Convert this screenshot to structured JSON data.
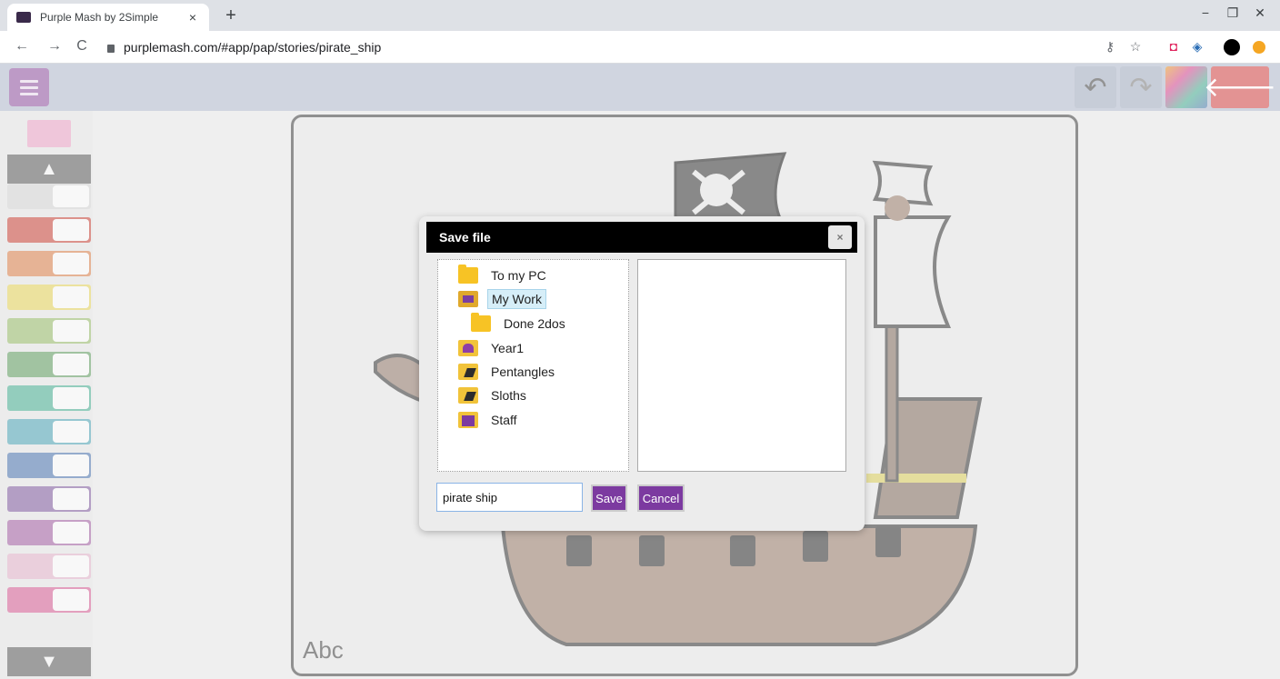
{
  "browser": {
    "tab_title": "Purple Mash by 2Simple",
    "tab_close": "×",
    "new_tab": "+",
    "url": "purplemash.com/#app/pap/stories/pirate_ship",
    "nav": {
      "back": "←",
      "forward": "→",
      "reload": "C"
    },
    "window": {
      "minimize": "−",
      "maximize": "❐",
      "close": "✕"
    },
    "extensions": [
      "key-icon",
      "star-icon",
      "pocket-icon",
      "sync-icon",
      "profile-icon",
      "addon-icon"
    ]
  },
  "app": {
    "toolbar": {
      "undo": "↶",
      "redo": "↷",
      "back": "🡐"
    },
    "canvas_label": "Abc",
    "pens": [
      {
        "color": "#d3d3d3"
      },
      {
        "color": "#c9574e"
      },
      {
        "color": "#d98a5c"
      },
      {
        "color": "#e2d36a"
      },
      {
        "color": "#9fbe77"
      },
      {
        "color": "#6fa36f"
      },
      {
        "color": "#5ab39a"
      },
      {
        "color": "#5fa9b8"
      },
      {
        "color": "#5d80b3"
      },
      {
        "color": "#8a6aa5"
      },
      {
        "color": "#a86ea8"
      },
      {
        "color": "#dfb5c9"
      },
      {
        "color": "#d46c9c"
      }
    ]
  },
  "dialog": {
    "title": "Save file",
    "close": "×",
    "folders": [
      {
        "label": "To my PC",
        "icon": "folder-icon"
      },
      {
        "label": "My Work",
        "icon": "open-folder-icon",
        "selected": true
      },
      {
        "label": "Done 2dos",
        "icon": "folder-icon"
      },
      {
        "label": "Year1",
        "icon": "group-folder-icon"
      },
      {
        "label": "Pentangles",
        "icon": "class-folder-icon"
      },
      {
        "label": "Sloths",
        "icon": "class-folder-icon"
      },
      {
        "label": "Staff",
        "icon": "staff-folder-icon"
      }
    ],
    "filename_value": "pirate ship",
    "save_label": "Save",
    "cancel_label": "Cancel"
  }
}
